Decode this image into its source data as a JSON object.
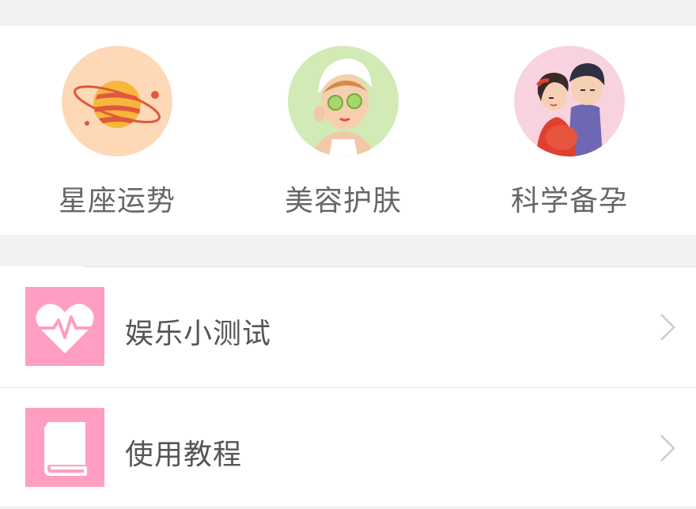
{
  "grid": [
    {
      "label": "星座运势",
      "icon": "planet-icon",
      "bg": "#fdd9b8"
    },
    {
      "label": "美容护肤",
      "icon": "beauty-face-icon",
      "bg": "#d2eab5"
    },
    {
      "label": "科学备孕",
      "icon": "couple-pregnancy-icon",
      "bg": "#f9d2df"
    }
  ],
  "list": [
    {
      "label": "娱乐小测试",
      "icon": "heartbeat-icon"
    },
    {
      "label": "使用教程",
      "icon": "book-icon"
    }
  ],
  "colors": {
    "accent": "#ff9ec2",
    "chevron": "#cccccc"
  }
}
